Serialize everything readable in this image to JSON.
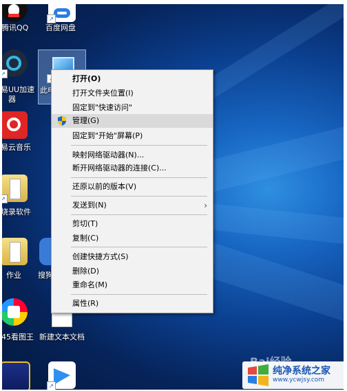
{
  "desktop_icons": [
    {
      "label": "腾讯QQ"
    },
    {
      "label": "百度网盘"
    },
    {
      "label": "易UU加速"
    },
    {
      "label": "器"
    },
    {
      "label": "此电"
    },
    {
      "label": "易云音乐"
    },
    {
      "label": "烧录软件"
    },
    {
      "label": "作业"
    },
    {
      "label": "搜狗"
    },
    {
      "label": "45看图王"
    },
    {
      "label": "新建文本文档"
    }
  ],
  "context_menu": {
    "items": [
      {
        "label": "打开(O)"
      },
      {
        "label": "打开文件夹位置(I)"
      },
      {
        "label": "固定到\"快速访问\""
      },
      {
        "label": "管理(G)"
      },
      {
        "label": "固定到\"开始\"屏幕(P)"
      },
      {
        "label": "映射网络驱动器(N)..."
      },
      {
        "label": "断开网络驱动器的连接(C)..."
      },
      {
        "label": "还原以前的版本(V)"
      },
      {
        "label": "发送到(N)"
      },
      {
        "label": "剪切(T)"
      },
      {
        "label": "复制(C)"
      },
      {
        "label": "创建快捷方式(S)"
      },
      {
        "label": "删除(D)"
      },
      {
        "label": "重命名(M)"
      },
      {
        "label": "属性(R)"
      }
    ],
    "submenu_arrow": "›"
  },
  "watermark": {
    "title": "纯净系统之家",
    "url": "www.ycwjsy.com",
    "baidu": "Bai经验"
  },
  "colors": {
    "desktop": "#0b3f8f",
    "menu_bg": "#f2f2f2",
    "menu_hover": "#dadada"
  },
  "icons": [
    "windows-logo-icon",
    "shield-icon",
    "chevron-right-icon",
    "shortcut-arrow-icon"
  ]
}
